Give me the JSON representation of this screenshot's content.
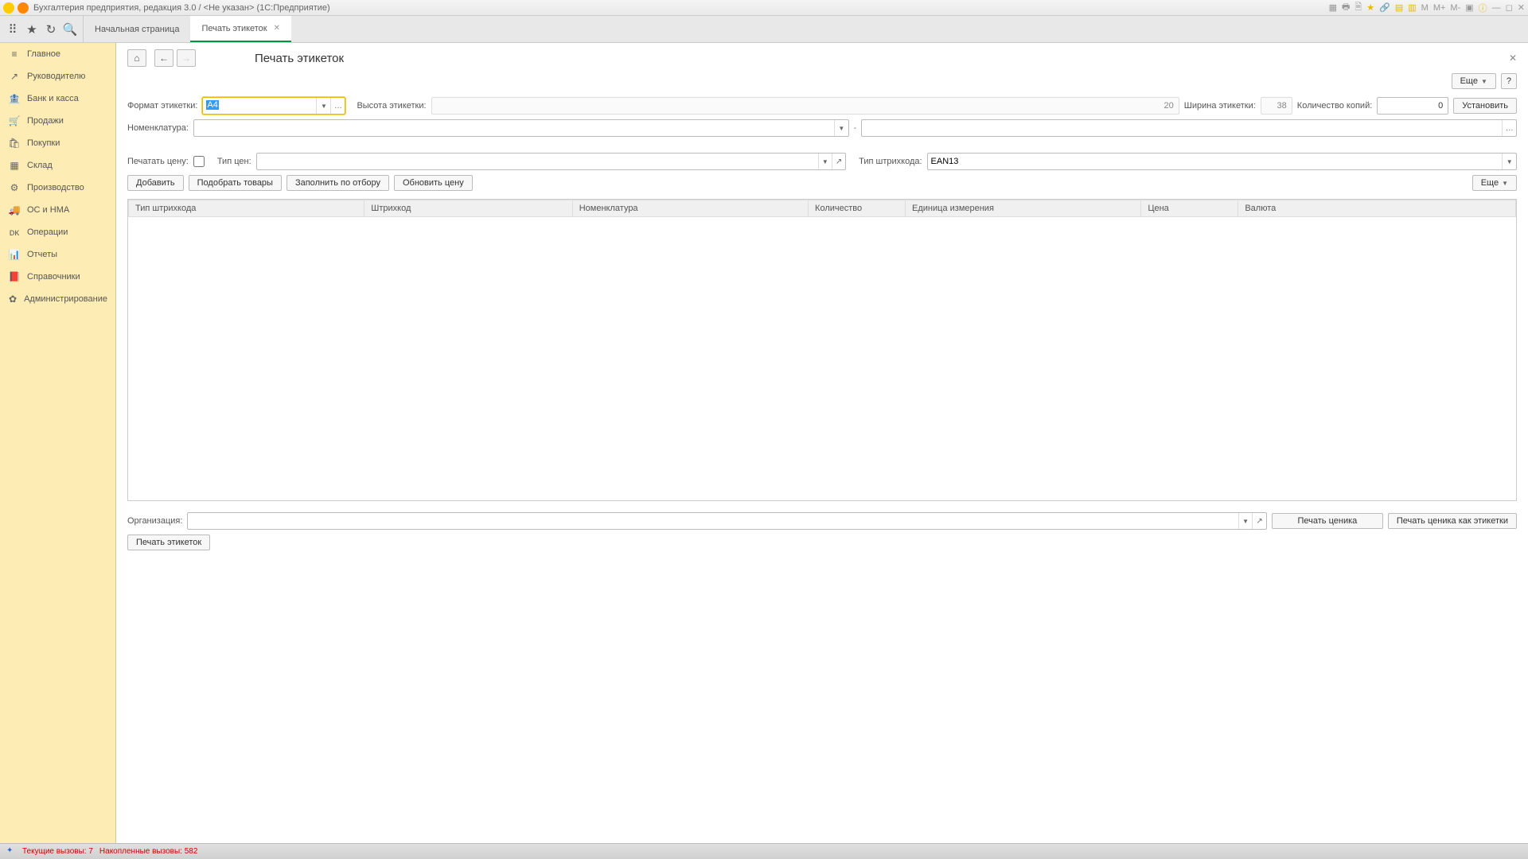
{
  "app_title": "Бухгалтерия предприятия, редакция 3.0 / <Не указан>  (1С:Предприятие)",
  "titlebar_right": [
    "M",
    "M+",
    "M-"
  ],
  "tabs": {
    "home": "Начальная страница",
    "active": "Печать этикеток"
  },
  "sidebar": [
    {
      "icon": "≡",
      "label": "Главное"
    },
    {
      "icon": "↗",
      "label": "Руководителю"
    },
    {
      "icon": "🏦",
      "label": "Банк и касса"
    },
    {
      "icon": "🛒",
      "label": "Продажи"
    },
    {
      "icon": "🛍",
      "label": "Покупки"
    },
    {
      "icon": "▦",
      "label": "Склад"
    },
    {
      "icon": "⚙",
      "label": "Производство"
    },
    {
      "icon": "🚚",
      "label": "ОС и НМА"
    },
    {
      "icon": "ᴅᴋ",
      "label": "Операции"
    },
    {
      "icon": "📊",
      "label": "Отчеты"
    },
    {
      "icon": "📕",
      "label": "Справочники"
    },
    {
      "icon": "✿",
      "label": "Администрирование"
    }
  ],
  "page": {
    "title": "Печать этикеток",
    "more_btn": "Еще",
    "help_btn": "?",
    "labels": {
      "format": "Формат этикетки:",
      "height": "Высота этикетки:",
      "width": "Ширина этикетки:",
      "copies": "Количество копий:",
      "set_btn": "Установить",
      "nomen": "Номенклатура:",
      "print_price": "Печатать цену:",
      "price_type": "Тип цен:",
      "barcode_type": "Тип штрихкода:"
    },
    "values": {
      "format": "А4",
      "height": "20",
      "width": "38",
      "copies": "0",
      "barcode_type": "EAN13"
    },
    "buttons": {
      "add": "Добавить",
      "pick": "Подобрать товары",
      "fill": "Заполнить по отбору",
      "refresh": "Обновить цену",
      "more2": "Еще"
    },
    "columns": [
      "Тип штрихкода",
      "Штрихкод",
      "Номенклатура",
      "Количество",
      "Единица измерения",
      "Цена",
      "Валюта"
    ],
    "org_label": "Организация:",
    "print_pricelist": "Печать ценика",
    "print_pricelist_as_labels": "Печать ценика как этикетки",
    "print_labels": "Печать этикеток"
  },
  "status": {
    "current": "Текущие вызовы: 7",
    "accum": "Накопленные вызовы: 582"
  }
}
